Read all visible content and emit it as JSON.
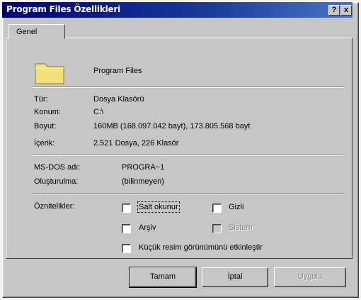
{
  "window": {
    "title": "Program Files Özellikleri",
    "help_label": "?",
    "close_label": "x"
  },
  "tabs": [
    {
      "label": "Genel"
    }
  ],
  "folder": {
    "name": "Program Files",
    "icon": "folder-icon"
  },
  "info": {
    "type_label": "Tür:",
    "type_value": "Dosya Klasörü",
    "location_label": "Konum:",
    "location_value": "C:\\",
    "size_label": "Boyut:",
    "size_value": "160MB (168.097.042 bayt), 173.805.568 bayt",
    "contents_label": "İçerik:",
    "contents_value": "2.521 Dosya, 226 Klasör",
    "msdos_label": "MS-DOS adı:",
    "msdos_value": "PROGRA~1",
    "created_label": "Oluşturulma:",
    "created_value": "(bilinmeyen)",
    "attributes_label": "Öznitelikler:"
  },
  "attributes": {
    "readonly": "Salt okunur",
    "hidden": "Gizli",
    "archive": "Arşiv",
    "system": "Sistem",
    "thumbnail": "Küçük resim görünümünü etkinleştir"
  },
  "buttons": {
    "ok": "Tamam",
    "cancel": "İptal",
    "apply": "Uygula"
  },
  "colors": {
    "titlebar_start": "#00007c",
    "titlebar_end": "#4a74c8",
    "face": "#c6c6c6"
  }
}
